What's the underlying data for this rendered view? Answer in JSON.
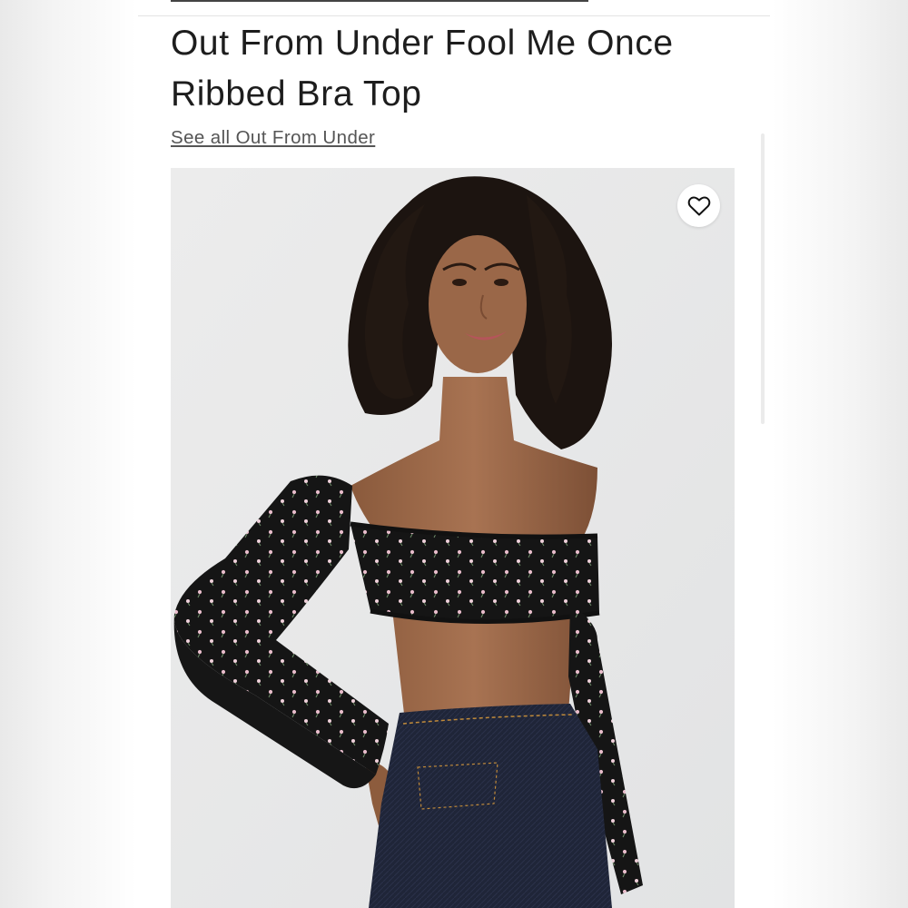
{
  "product": {
    "title_line1": "Out From Under Fool Me Once",
    "title_line2": "Ribbed Bra Top",
    "brand_link": "See all Out From Under"
  },
  "image": {
    "alt": "Model wearing black floral ribbed off-the-shoulder bra top with sleeves and dark jeans",
    "background_color": "#e8e9ea",
    "garment_color": "#141414",
    "print_color": "#e7b9c6",
    "denim_color": "#1f2538"
  },
  "icons": {
    "wishlist": "heart-outline-icon"
  }
}
